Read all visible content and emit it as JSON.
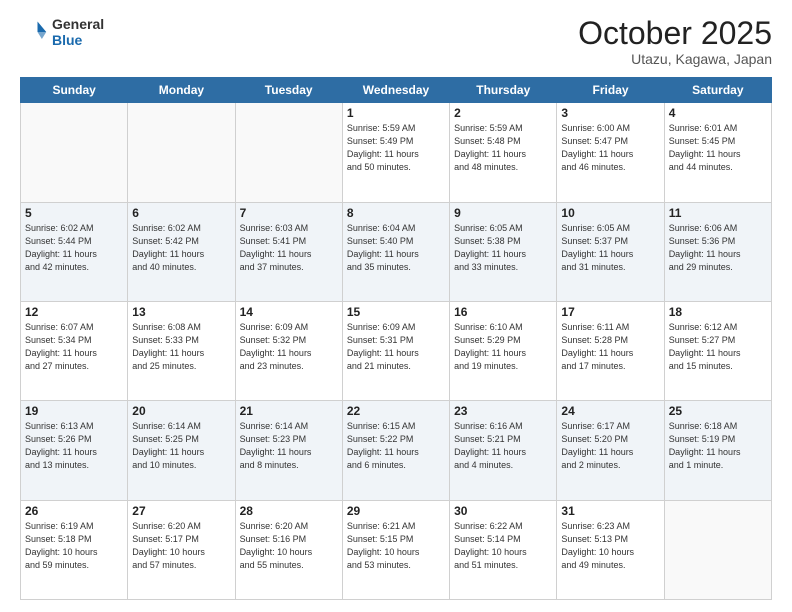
{
  "header": {
    "logo_general": "General",
    "logo_blue": "Blue",
    "month_title": "October 2025",
    "subtitle": "Utazu, Kagawa, Japan"
  },
  "weekdays": [
    "Sunday",
    "Monday",
    "Tuesday",
    "Wednesday",
    "Thursday",
    "Friday",
    "Saturday"
  ],
  "weeks": [
    [
      {
        "day": "",
        "info": ""
      },
      {
        "day": "",
        "info": ""
      },
      {
        "day": "",
        "info": ""
      },
      {
        "day": "1",
        "info": "Sunrise: 5:59 AM\nSunset: 5:49 PM\nDaylight: 11 hours\nand 50 minutes."
      },
      {
        "day": "2",
        "info": "Sunrise: 5:59 AM\nSunset: 5:48 PM\nDaylight: 11 hours\nand 48 minutes."
      },
      {
        "day": "3",
        "info": "Sunrise: 6:00 AM\nSunset: 5:47 PM\nDaylight: 11 hours\nand 46 minutes."
      },
      {
        "day": "4",
        "info": "Sunrise: 6:01 AM\nSunset: 5:45 PM\nDaylight: 11 hours\nand 44 minutes."
      }
    ],
    [
      {
        "day": "5",
        "info": "Sunrise: 6:02 AM\nSunset: 5:44 PM\nDaylight: 11 hours\nand 42 minutes."
      },
      {
        "day": "6",
        "info": "Sunrise: 6:02 AM\nSunset: 5:42 PM\nDaylight: 11 hours\nand 40 minutes."
      },
      {
        "day": "7",
        "info": "Sunrise: 6:03 AM\nSunset: 5:41 PM\nDaylight: 11 hours\nand 37 minutes."
      },
      {
        "day": "8",
        "info": "Sunrise: 6:04 AM\nSunset: 5:40 PM\nDaylight: 11 hours\nand 35 minutes."
      },
      {
        "day": "9",
        "info": "Sunrise: 6:05 AM\nSunset: 5:38 PM\nDaylight: 11 hours\nand 33 minutes."
      },
      {
        "day": "10",
        "info": "Sunrise: 6:05 AM\nSunset: 5:37 PM\nDaylight: 11 hours\nand 31 minutes."
      },
      {
        "day": "11",
        "info": "Sunrise: 6:06 AM\nSunset: 5:36 PM\nDaylight: 11 hours\nand 29 minutes."
      }
    ],
    [
      {
        "day": "12",
        "info": "Sunrise: 6:07 AM\nSunset: 5:34 PM\nDaylight: 11 hours\nand 27 minutes."
      },
      {
        "day": "13",
        "info": "Sunrise: 6:08 AM\nSunset: 5:33 PM\nDaylight: 11 hours\nand 25 minutes."
      },
      {
        "day": "14",
        "info": "Sunrise: 6:09 AM\nSunset: 5:32 PM\nDaylight: 11 hours\nand 23 minutes."
      },
      {
        "day": "15",
        "info": "Sunrise: 6:09 AM\nSunset: 5:31 PM\nDaylight: 11 hours\nand 21 minutes."
      },
      {
        "day": "16",
        "info": "Sunrise: 6:10 AM\nSunset: 5:29 PM\nDaylight: 11 hours\nand 19 minutes."
      },
      {
        "day": "17",
        "info": "Sunrise: 6:11 AM\nSunset: 5:28 PM\nDaylight: 11 hours\nand 17 minutes."
      },
      {
        "day": "18",
        "info": "Sunrise: 6:12 AM\nSunset: 5:27 PM\nDaylight: 11 hours\nand 15 minutes."
      }
    ],
    [
      {
        "day": "19",
        "info": "Sunrise: 6:13 AM\nSunset: 5:26 PM\nDaylight: 11 hours\nand 13 minutes."
      },
      {
        "day": "20",
        "info": "Sunrise: 6:14 AM\nSunset: 5:25 PM\nDaylight: 11 hours\nand 10 minutes."
      },
      {
        "day": "21",
        "info": "Sunrise: 6:14 AM\nSunset: 5:23 PM\nDaylight: 11 hours\nand 8 minutes."
      },
      {
        "day": "22",
        "info": "Sunrise: 6:15 AM\nSunset: 5:22 PM\nDaylight: 11 hours\nand 6 minutes."
      },
      {
        "day": "23",
        "info": "Sunrise: 6:16 AM\nSunset: 5:21 PM\nDaylight: 11 hours\nand 4 minutes."
      },
      {
        "day": "24",
        "info": "Sunrise: 6:17 AM\nSunset: 5:20 PM\nDaylight: 11 hours\nand 2 minutes."
      },
      {
        "day": "25",
        "info": "Sunrise: 6:18 AM\nSunset: 5:19 PM\nDaylight: 11 hours\nand 1 minute."
      }
    ],
    [
      {
        "day": "26",
        "info": "Sunrise: 6:19 AM\nSunset: 5:18 PM\nDaylight: 10 hours\nand 59 minutes."
      },
      {
        "day": "27",
        "info": "Sunrise: 6:20 AM\nSunset: 5:17 PM\nDaylight: 10 hours\nand 57 minutes."
      },
      {
        "day": "28",
        "info": "Sunrise: 6:20 AM\nSunset: 5:16 PM\nDaylight: 10 hours\nand 55 minutes."
      },
      {
        "day": "29",
        "info": "Sunrise: 6:21 AM\nSunset: 5:15 PM\nDaylight: 10 hours\nand 53 minutes."
      },
      {
        "day": "30",
        "info": "Sunrise: 6:22 AM\nSunset: 5:14 PM\nDaylight: 10 hours\nand 51 minutes."
      },
      {
        "day": "31",
        "info": "Sunrise: 6:23 AM\nSunset: 5:13 PM\nDaylight: 10 hours\nand 49 minutes."
      },
      {
        "day": "",
        "info": ""
      }
    ]
  ]
}
